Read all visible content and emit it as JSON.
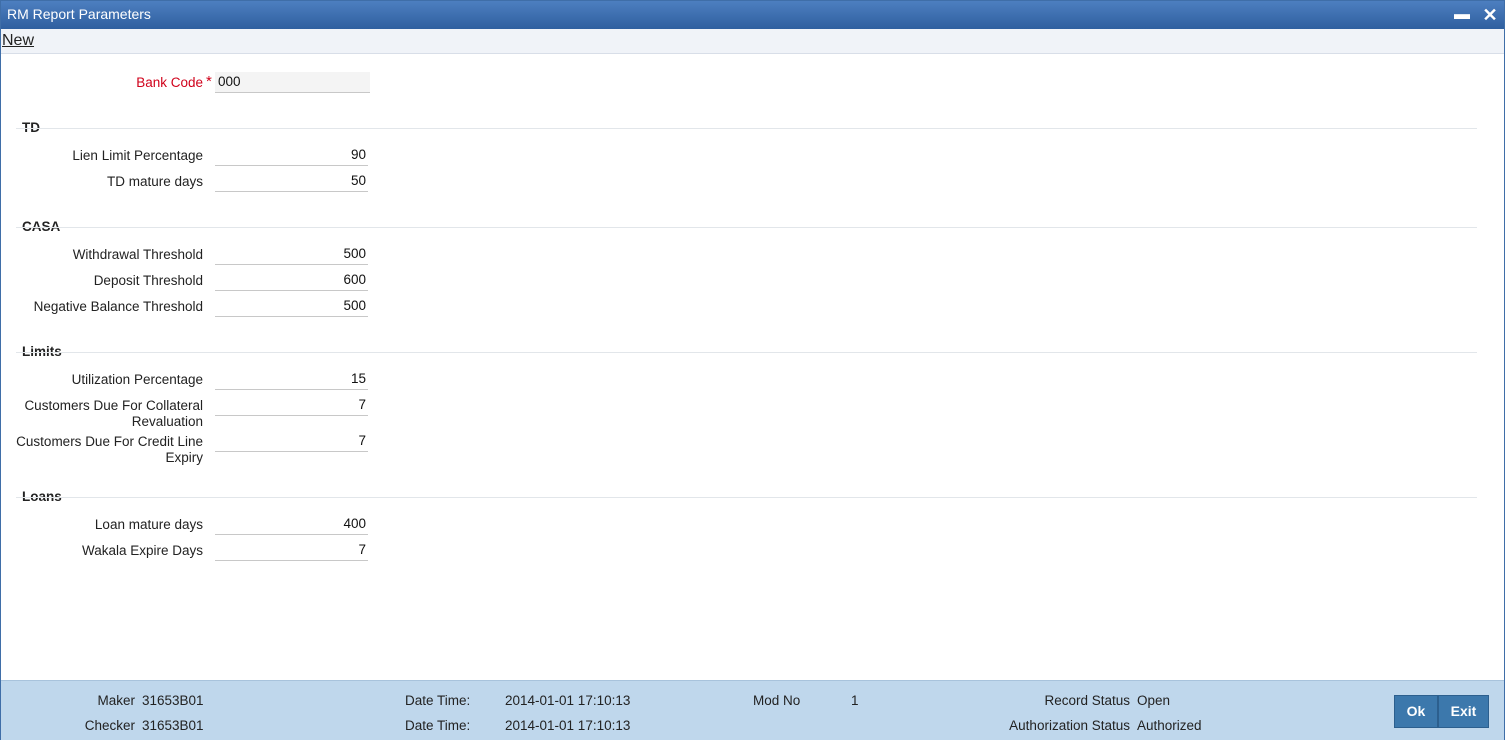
{
  "window": {
    "title": "RM Report Parameters",
    "minimize": "▬",
    "close": "✕"
  },
  "menu": {
    "new_label": "New"
  },
  "bank_code": {
    "label": "Bank Code",
    "required": "*",
    "value": "000"
  },
  "sections": {
    "td": {
      "title": "TD",
      "fields": [
        {
          "label": "Lien Limit Percentage",
          "value": "90"
        },
        {
          "label": "TD mature days",
          "value": "50"
        }
      ]
    },
    "casa": {
      "title": "CASA",
      "fields": [
        {
          "label": "Withdrawal Threshold",
          "value": "500"
        },
        {
          "label": "Deposit Threshold",
          "value": "600"
        },
        {
          "label": "Negative Balance Threshold",
          "value": "500"
        }
      ]
    },
    "limits": {
      "title": "Limits",
      "fields": [
        {
          "label": "Utilization Percentage",
          "value": "15"
        },
        {
          "label": "Customers Due For Collateral",
          "label2": "Revaluation",
          "value": "7"
        },
        {
          "label": "Customers Due For Credit Line",
          "label2": "Expiry",
          "value": "7"
        }
      ]
    },
    "loans": {
      "title": "Loans",
      "fields": [
        {
          "label": "Loan mature days",
          "value": "400"
        },
        {
          "label": "Wakala Expire Days",
          "value": "7"
        }
      ]
    }
  },
  "footer": {
    "maker_label": "Maker",
    "maker_value": "31653B01",
    "checker_label": "Checker",
    "checker_value": "31653B01",
    "datetime_label": "Date Time:",
    "maker_datetime": "2014-01-01 17:10:13",
    "checker_datetime": "2014-01-01 17:10:13",
    "mod_no_label": "Mod No",
    "mod_no_value": "1",
    "record_status_label": "Record Status",
    "record_status_value": "Open",
    "auth_status_label": "Authorization Status",
    "auth_status_value": "Authorized",
    "ok_label": "Ok",
    "exit_label": "Exit"
  }
}
